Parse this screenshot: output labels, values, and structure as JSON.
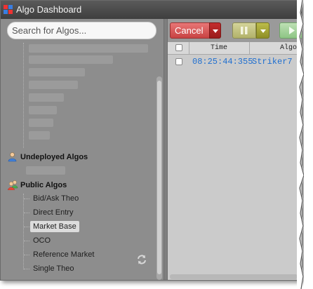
{
  "window": {
    "title": "Algo Dashboard"
  },
  "search": {
    "placeholder": "Search for Algos..."
  },
  "sections": {
    "undeployed": {
      "label": "Undeployed Algos"
    },
    "public": {
      "label": "Public Algos",
      "items": [
        {
          "label": "Bid/Ask Theo",
          "selected": false
        },
        {
          "label": "Direct Entry",
          "selected": false
        },
        {
          "label": "Market Base",
          "selected": true
        },
        {
          "label": "OCO",
          "selected": false
        },
        {
          "label": "Reference Market",
          "selected": false
        },
        {
          "label": "Single Theo",
          "selected": false
        }
      ]
    }
  },
  "toolbar": {
    "cancel_label": "Cancel"
  },
  "table": {
    "columns": [
      "Time",
      "AlgoN"
    ],
    "rows": [
      {
        "time": "08:25:44:355",
        "algo": "Striker7"
      }
    ]
  },
  "colors": {
    "cancel": "#c84343",
    "pause": "#b2b26a",
    "play": "#8ec585",
    "row_text": "#1f6fd0"
  },
  "icons": [
    "app-logo-icon",
    "user-icon",
    "users-group-icon",
    "refresh-icon",
    "pause-icon",
    "play-icon",
    "chevron-down-icon"
  ]
}
